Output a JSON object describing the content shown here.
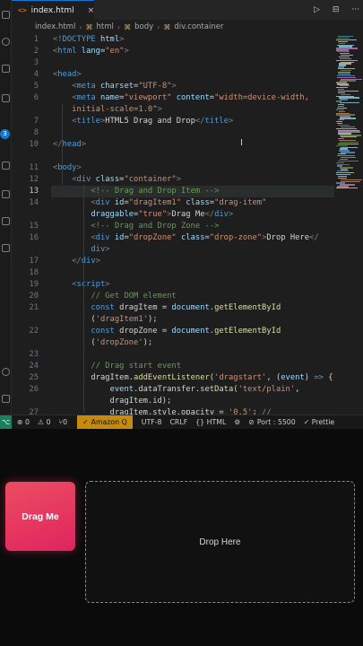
{
  "tab": {
    "icon": "<>",
    "label": "index.html",
    "close": "×"
  },
  "tab_actions": {
    "run": "▷",
    "split": "⊟",
    "more": "···"
  },
  "breadcrumb": {
    "file": "index.html",
    "tag1": "html",
    "tag2": "body",
    "tag3": "div.container",
    "sep": "›",
    "tag_icon": "⌘"
  },
  "activity_badge": "3",
  "code": {
    "current_line": 13,
    "lines": [
      {
        "n": "1",
        "tokens": [
          [
            "t-punc",
            "<"
          ],
          [
            "t-tag",
            "!DOCTYPE"
          ],
          [
            "t-txt",
            " "
          ],
          [
            "t-attr",
            "html"
          ],
          [
            "t-punc",
            ">"
          ]
        ]
      },
      {
        "n": "2",
        "tokens": [
          [
            "t-punc",
            "<"
          ],
          [
            "t-tag",
            "html"
          ],
          [
            "t-txt",
            " "
          ],
          [
            "t-attr",
            "lang"
          ],
          [
            "t-txt",
            "="
          ],
          [
            "t-str",
            "\"en\""
          ],
          [
            "t-punc",
            ">"
          ]
        ]
      },
      {
        "n": "3",
        "tokens": []
      },
      {
        "n": "4",
        "tokens": [
          [
            "t-punc",
            "<"
          ],
          [
            "t-tag",
            "head"
          ],
          [
            "t-punc",
            ">"
          ]
        ]
      },
      {
        "n": "5",
        "tokens": [
          [
            "t-txt",
            "    "
          ],
          [
            "t-punc",
            "<"
          ],
          [
            "t-tag",
            "meta"
          ],
          [
            "t-txt",
            " "
          ],
          [
            "t-attr",
            "charset"
          ],
          [
            "t-txt",
            "="
          ],
          [
            "t-str",
            "\"UTF-8\""
          ],
          [
            "t-punc",
            ">"
          ]
        ]
      },
      {
        "n": "6",
        "tokens": [
          [
            "t-txt",
            "    "
          ],
          [
            "t-punc",
            "<"
          ],
          [
            "t-tag",
            "meta"
          ],
          [
            "t-txt",
            " "
          ],
          [
            "t-attr",
            "name"
          ],
          [
            "t-txt",
            "="
          ],
          [
            "t-str",
            "\"viewport\""
          ],
          [
            "t-txt",
            " "
          ],
          [
            "t-attr",
            "content"
          ],
          [
            "t-txt",
            "="
          ],
          [
            "t-str",
            "\"width=device-width,"
          ]
        ]
      },
      {
        "n": "",
        "tokens": [
          [
            "t-str",
            "    initial-scale=1.0\""
          ],
          [
            "t-punc",
            ">"
          ]
        ]
      },
      {
        "n": "7",
        "tokens": [
          [
            "t-txt",
            "    "
          ],
          [
            "t-punc",
            "<"
          ],
          [
            "t-tag",
            "title"
          ],
          [
            "t-punc",
            ">"
          ],
          [
            "t-txt",
            "HTML5 Drag and Drop"
          ],
          [
            "t-punc",
            "</"
          ],
          [
            "t-tag",
            "title"
          ],
          [
            "t-punc",
            ">"
          ]
        ]
      },
      {
        "n": "8",
        "tokens": []
      },
      {
        "n": "10",
        "tokens": [
          [
            "t-punc",
            "</"
          ],
          [
            "t-tag",
            "head"
          ],
          [
            "t-punc",
            ">"
          ]
        ]
      },
      {
        "n": "",
        "tokens": []
      },
      {
        "n": "11",
        "tokens": [
          [
            "t-punc",
            "<"
          ],
          [
            "t-tag",
            "body"
          ],
          [
            "t-punc",
            ">"
          ]
        ]
      },
      {
        "n": "12",
        "tokens": [
          [
            "t-txt",
            "    "
          ],
          [
            "t-punc",
            "<"
          ],
          [
            "t-tag",
            "div"
          ],
          [
            "t-txt",
            " "
          ],
          [
            "t-attr",
            "class"
          ],
          [
            "t-txt",
            "="
          ],
          [
            "t-str",
            "\"container\""
          ],
          [
            "t-punc",
            ">"
          ]
        ]
      },
      {
        "n": "13",
        "tokens": [
          [
            "t-txt",
            "        "
          ],
          [
            "t-com",
            "<!-- Drag and Drop Item -->"
          ]
        ]
      },
      {
        "n": "14",
        "tokens": [
          [
            "t-txt",
            "        "
          ],
          [
            "t-punc",
            "<"
          ],
          [
            "t-tag",
            "div"
          ],
          [
            "t-txt",
            " "
          ],
          [
            "t-attr",
            "id"
          ],
          [
            "t-txt",
            "="
          ],
          [
            "t-str",
            "\"dragItem1\""
          ],
          [
            "t-txt",
            " "
          ],
          [
            "t-attr",
            "class"
          ],
          [
            "t-txt",
            "="
          ],
          [
            "t-str",
            "\"drag-item\""
          ]
        ]
      },
      {
        "n": "",
        "tokens": [
          [
            "t-txt",
            "        "
          ],
          [
            "t-attr",
            "draggable"
          ],
          [
            "t-txt",
            "="
          ],
          [
            "t-str",
            "\"true\""
          ],
          [
            "t-punc",
            ">"
          ],
          [
            "t-txt",
            "Drag Me"
          ],
          [
            "t-punc",
            "</"
          ],
          [
            "t-tag",
            "div"
          ],
          [
            "t-punc",
            ">"
          ]
        ]
      },
      {
        "n": "15",
        "tokens": [
          [
            "t-txt",
            "        "
          ],
          [
            "t-com",
            "<!-- Drag and Drop Zone -->"
          ]
        ]
      },
      {
        "n": "16",
        "tokens": [
          [
            "t-txt",
            "        "
          ],
          [
            "t-punc",
            "<"
          ],
          [
            "t-tag",
            "div"
          ],
          [
            "t-txt",
            " "
          ],
          [
            "t-attr",
            "id"
          ],
          [
            "t-txt",
            "="
          ],
          [
            "t-str",
            "\"dropZone\""
          ],
          [
            "t-txt",
            " "
          ],
          [
            "t-attr",
            "class"
          ],
          [
            "t-txt",
            "="
          ],
          [
            "t-str",
            "\"drop-zone\""
          ],
          [
            "t-punc",
            ">"
          ],
          [
            "t-txt",
            "Drop Here"
          ],
          [
            "t-punc",
            "</"
          ]
        ]
      },
      {
        "n": "",
        "tokens": [
          [
            "t-txt",
            "        "
          ],
          [
            "t-tag",
            "div"
          ],
          [
            "t-punc",
            ">"
          ]
        ]
      },
      {
        "n": "17",
        "tokens": [
          [
            "t-txt",
            "    "
          ],
          [
            "t-punc",
            "</"
          ],
          [
            "t-tag",
            "div"
          ],
          [
            "t-punc",
            ">"
          ]
        ]
      },
      {
        "n": "18",
        "tokens": []
      },
      {
        "n": "19",
        "tokens": [
          [
            "t-txt",
            "    "
          ],
          [
            "t-punc",
            "<"
          ],
          [
            "t-tag",
            "script"
          ],
          [
            "t-punc",
            ">"
          ]
        ]
      },
      {
        "n": "20",
        "tokens": [
          [
            "t-txt",
            "        "
          ],
          [
            "t-com",
            "// Get DOM element"
          ]
        ]
      },
      {
        "n": "21",
        "tokens": [
          [
            "t-txt",
            "        "
          ],
          [
            "t-kw",
            "const"
          ],
          [
            "t-txt",
            " dragItem "
          ],
          [
            "t-txt",
            "= "
          ],
          [
            "t-var",
            "document"
          ],
          [
            "t-txt",
            "."
          ],
          [
            "t-fn",
            "getElementById"
          ]
        ]
      },
      {
        "n": "",
        "tokens": [
          [
            "t-txt",
            "        ("
          ],
          [
            "t-str",
            "'dragItem1'"
          ],
          [
            "t-txt",
            ");"
          ]
        ]
      },
      {
        "n": "22",
        "tokens": [
          [
            "t-txt",
            "        "
          ],
          [
            "t-kw",
            "const"
          ],
          [
            "t-txt",
            " dropZone "
          ],
          [
            "t-txt",
            "= "
          ],
          [
            "t-var",
            "document"
          ],
          [
            "t-txt",
            "."
          ],
          [
            "t-fn",
            "getElementById"
          ]
        ]
      },
      {
        "n": "",
        "tokens": [
          [
            "t-txt",
            "        ("
          ],
          [
            "t-str",
            "'dropZone'"
          ],
          [
            "t-txt",
            ");"
          ]
        ]
      },
      {
        "n": "23",
        "tokens": []
      },
      {
        "n": "24",
        "tokens": [
          [
            "t-txt",
            "        "
          ],
          [
            "t-com",
            "// Drag start event"
          ]
        ]
      },
      {
        "n": "25",
        "tokens": [
          [
            "t-txt",
            "        dragItem."
          ],
          [
            "t-fn",
            "addEventListener"
          ],
          [
            "t-txt",
            "("
          ],
          [
            "t-str",
            "'dragstart'"
          ],
          [
            "t-txt",
            ", ("
          ],
          [
            "t-var",
            "event"
          ],
          [
            "t-txt",
            ") "
          ],
          [
            "t-kw",
            "=>"
          ],
          [
            "t-txt",
            " {"
          ]
        ]
      },
      {
        "n": "26",
        "tokens": [
          [
            "t-txt",
            "            "
          ],
          [
            "t-var",
            "event"
          ],
          [
            "t-txt",
            ".dataTransfer."
          ],
          [
            "t-fn",
            "setData"
          ],
          [
            "t-txt",
            "("
          ],
          [
            "t-str",
            "'text/plain'"
          ],
          [
            "t-txt",
            ","
          ]
        ]
      },
      {
        "n": "",
        "tokens": [
          [
            "t-txt",
            "            dragItem.id);"
          ]
        ]
      },
      {
        "n": "27",
        "tokens": [
          [
            "t-txt",
            "            dragItem.style.opacity = "
          ],
          [
            "t-str",
            "'0.5'"
          ],
          [
            "t-txt",
            "; "
          ],
          [
            "t-com",
            "//"
          ]
        ]
      }
    ]
  },
  "status": {
    "remote": "⌥",
    "errors": "⊗ 0",
    "warnings": "⚠ 0",
    "ports": "⑂0",
    "amazon_q": "Amazon Q",
    "encoding": "UTF-8",
    "eol": "CRLF",
    "language": "{} HTML",
    "port": "Port : 5500",
    "prettier": "✓ Prettie"
  },
  "preview": {
    "drag_item_label": "Drag Me",
    "drop_zone_label": "Drop Here"
  },
  "colors": {
    "accent": "#0e7ad8",
    "drag_item": "#e8365f",
    "status_amazon": "#c88a0b"
  }
}
